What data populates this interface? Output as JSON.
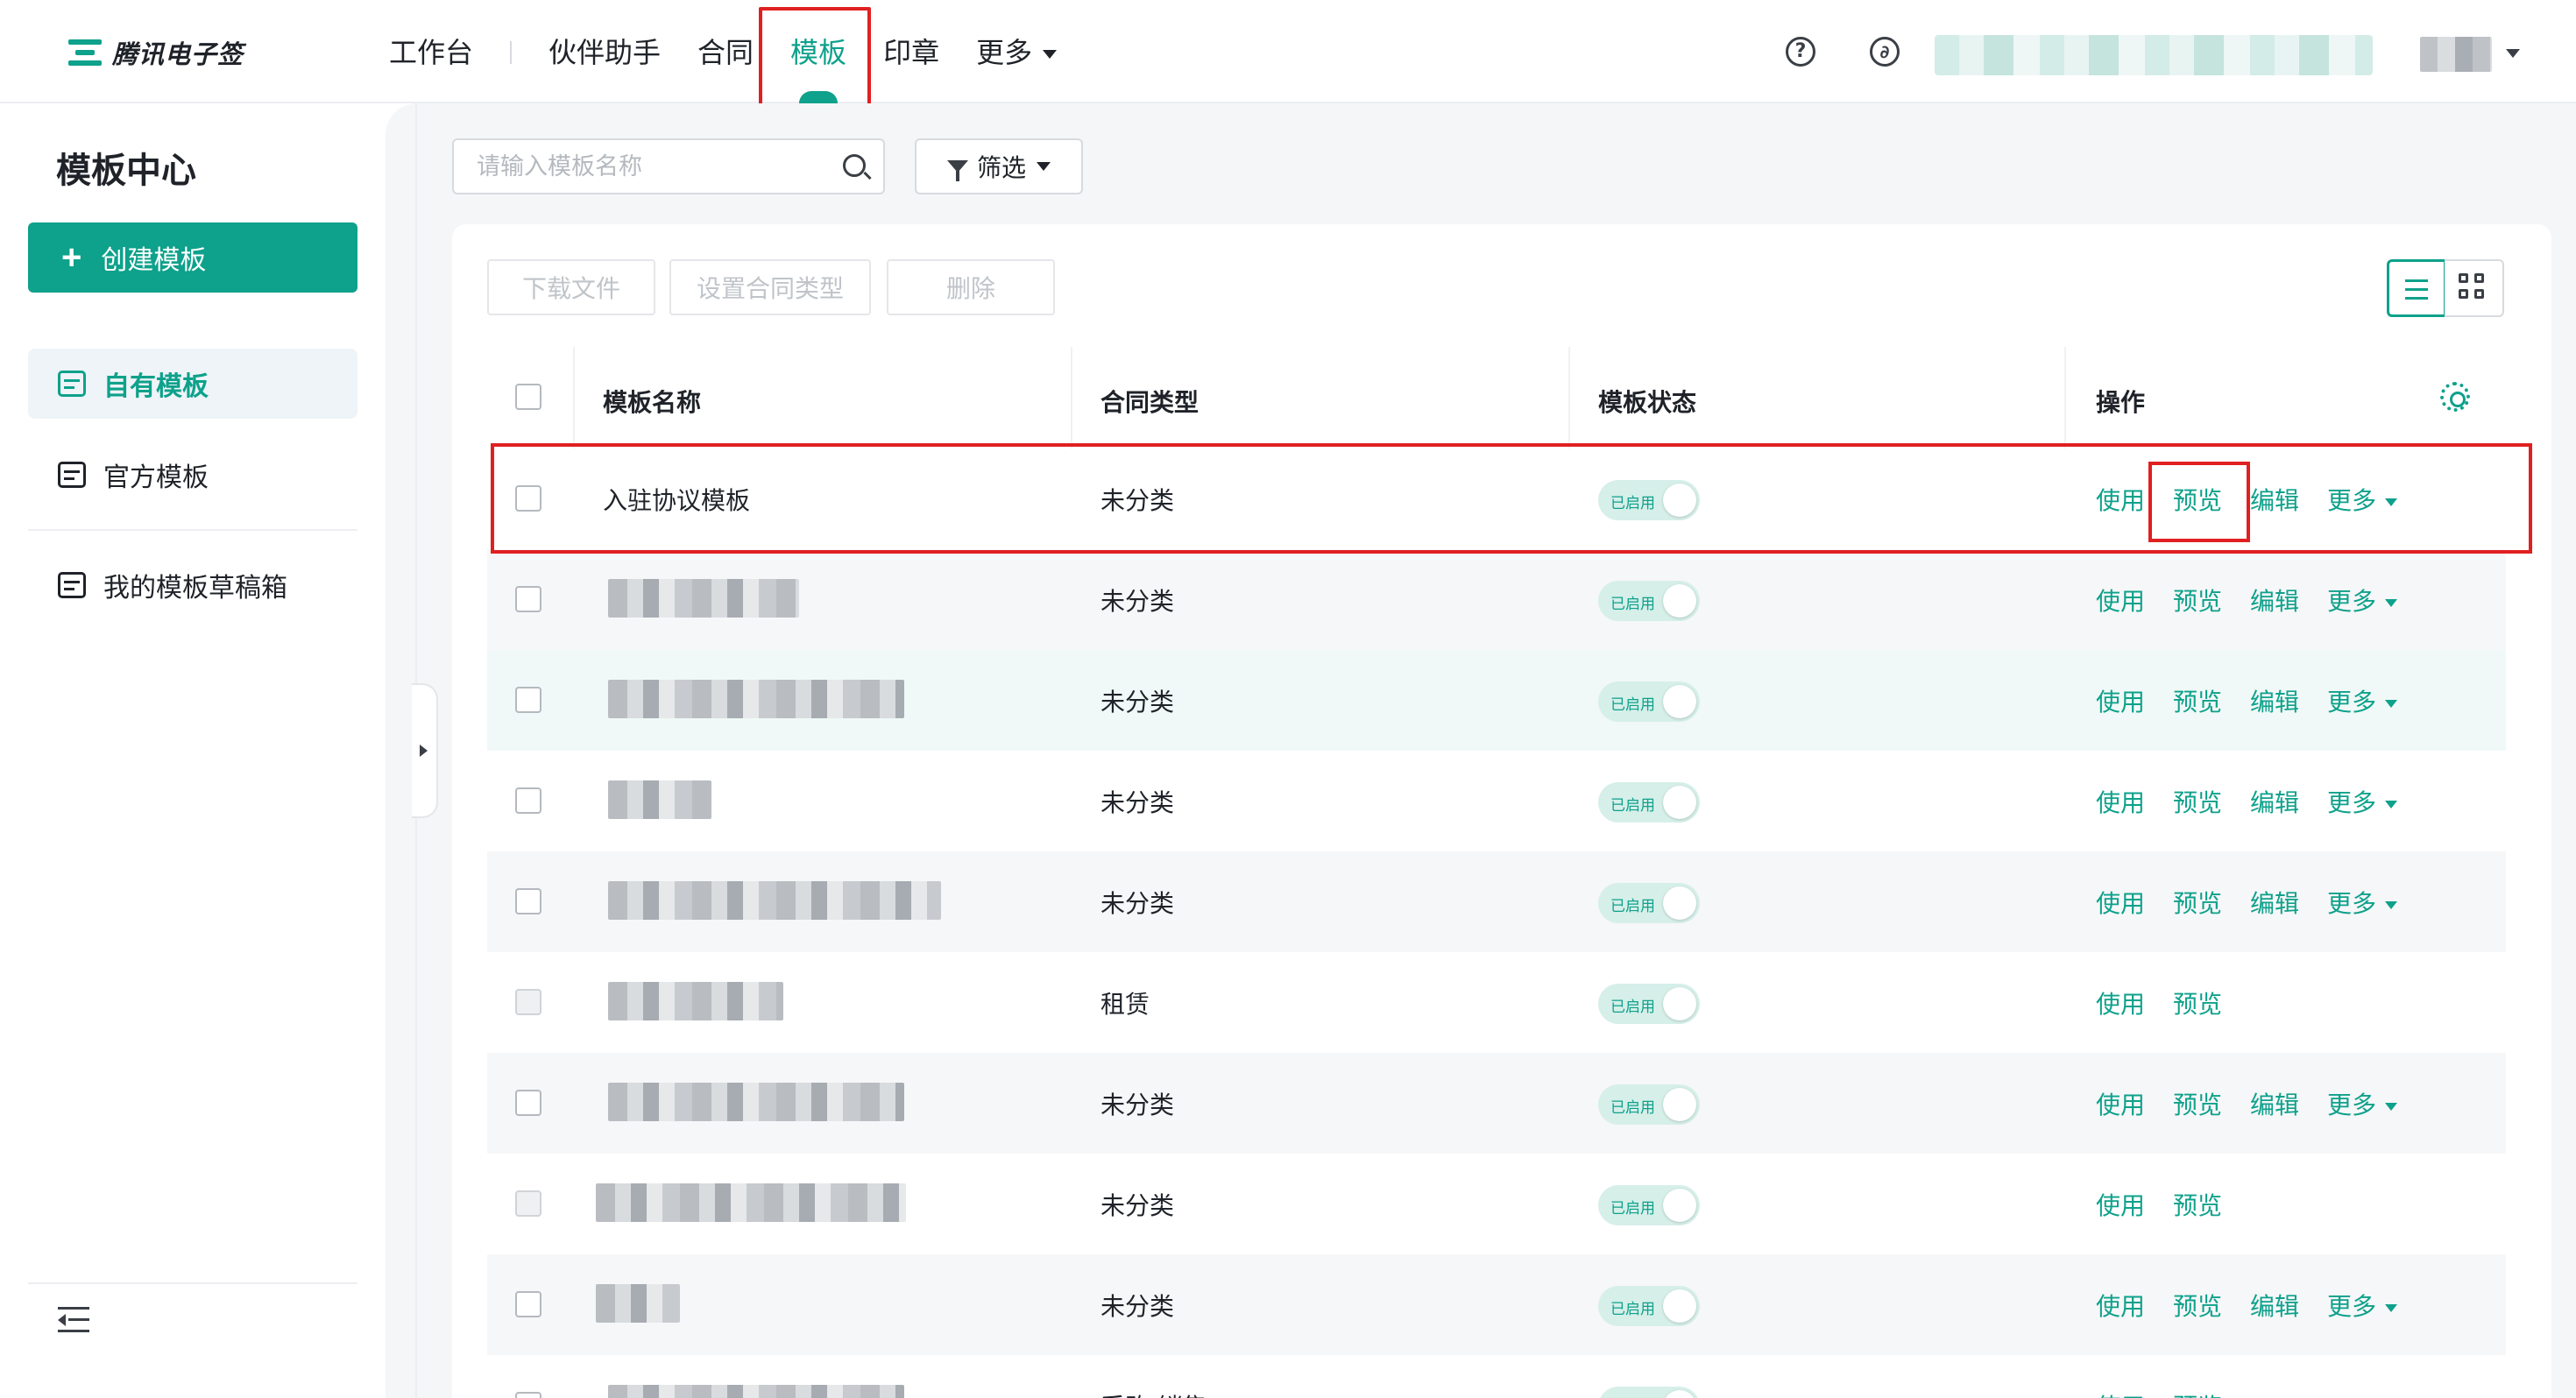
{
  "app": {
    "logo_text": "腾讯电子签",
    "brand_color": "#0ea18b",
    "highlight_color": "#e02020"
  },
  "nav": {
    "items": [
      {
        "label": "工作台"
      },
      {
        "label": "伙伴助手"
      },
      {
        "label": "合同"
      },
      {
        "label": "模板",
        "active": true
      },
      {
        "label": "印章"
      },
      {
        "label": "更多"
      }
    ],
    "icons": [
      "help-icon",
      "link-icon"
    ]
  },
  "sidebar": {
    "title": "模板中心",
    "create_label": "创建模板",
    "items": [
      {
        "label": "自有模板",
        "active": true,
        "icon": "template-icon"
      },
      {
        "label": "官方模板",
        "icon": "official-template-icon"
      },
      {
        "label": "我的模板草稿箱",
        "icon": "draft-box-icon"
      }
    ]
  },
  "toolbar": {
    "search_placeholder": "请输入模板名称",
    "filter_label": "筛选",
    "download_label": "下载文件",
    "set_type_label": "设置合同类型",
    "delete_label": "删除"
  },
  "table": {
    "headers": {
      "name": "模板名称",
      "type": "合同类型",
      "status": "模板状态",
      "actions": "操作"
    },
    "status_label": "已启用",
    "action_labels": {
      "use": "使用",
      "preview": "预览",
      "edit": "编辑",
      "more": "更多"
    },
    "rows": [
      {
        "name": "入驻协议模板",
        "type": "未分类",
        "enabled": true,
        "actions": [
          "use",
          "preview",
          "edit",
          "more"
        ]
      },
      {
        "name": "",
        "type": "未分类",
        "enabled": true,
        "actions": [
          "use",
          "preview",
          "edit",
          "more"
        ]
      },
      {
        "name": "",
        "type": "未分类",
        "enabled": true,
        "actions": [
          "use",
          "preview",
          "edit",
          "more"
        ]
      },
      {
        "name": "",
        "type": "未分类",
        "enabled": true,
        "actions": [
          "use",
          "preview",
          "edit",
          "more"
        ]
      },
      {
        "name": "",
        "type": "未分类",
        "enabled": true,
        "actions": [
          "use",
          "preview",
          "edit",
          "more"
        ]
      },
      {
        "name": "",
        "type": "租赁",
        "enabled": true,
        "actions": [
          "use",
          "preview"
        ]
      },
      {
        "name": "",
        "type": "未分类",
        "enabled": true,
        "actions": [
          "use",
          "preview",
          "edit",
          "more"
        ]
      },
      {
        "name": "",
        "type": "未分类",
        "enabled": true,
        "actions": [
          "use",
          "preview"
        ]
      },
      {
        "name": "",
        "type": "未分类",
        "enabled": true,
        "actions": [
          "use",
          "preview",
          "edit",
          "more"
        ]
      },
      {
        "name": "",
        "type": "采购/销售",
        "enabled": true,
        "actions": [
          "use",
          "preview"
        ]
      }
    ]
  }
}
